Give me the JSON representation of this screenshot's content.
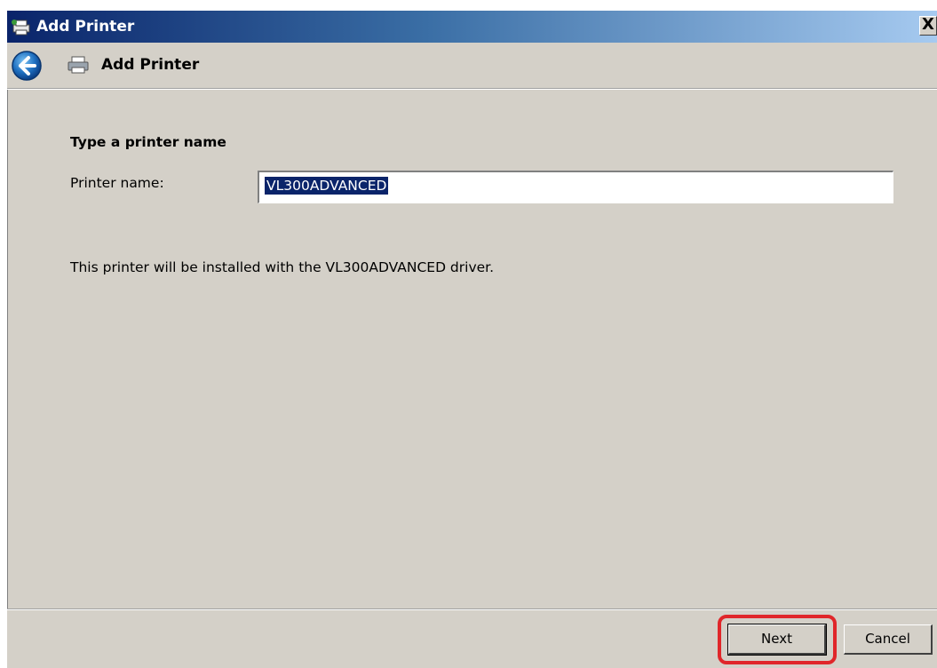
{
  "window": {
    "title": "Add Printer",
    "close_label": "X"
  },
  "header": {
    "title": "Add Printer"
  },
  "main": {
    "heading": "Type a printer name",
    "printer_name_label": "Printer name:",
    "printer_name_value": "VL300ADVANCED",
    "info_text": "This printer will be installed with the VL300ADVANCED driver."
  },
  "footer": {
    "next_label": "Next",
    "cancel_label": "Cancel"
  },
  "colors": {
    "titlebar_start": "#0a246a",
    "titlebar_end": "#a6caf0",
    "dialog_bg": "#d4d0c8",
    "selection_bg": "#0a246a",
    "highlight_ring": "#e0262a"
  },
  "icons": {
    "title": "printer-add-icon",
    "back": "back-arrow-icon",
    "header": "printer-icon",
    "close": "close-icon"
  }
}
